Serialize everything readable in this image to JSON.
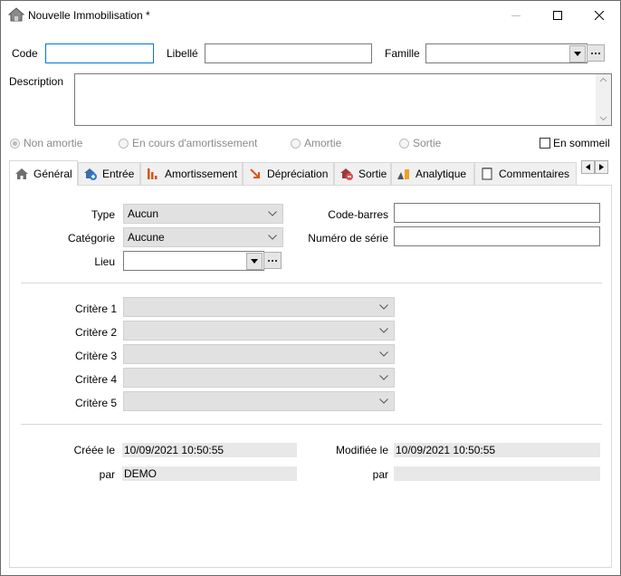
{
  "window": {
    "title": "Nouvelle Immobilisation *"
  },
  "header": {
    "code_label": "Code",
    "code_value": "",
    "libelle_label": "Libellé",
    "libelle_value": "",
    "famille_label": "Famille",
    "famille_value": "",
    "description_label": "Description",
    "description_value": ""
  },
  "status": {
    "options": [
      "Non amortie",
      "En cours d'amortissement",
      "Amortie",
      "Sortie"
    ],
    "selected": "Non amortie",
    "en_sommeil_label": "En sommeil",
    "en_sommeil_checked": false
  },
  "tabs": [
    {
      "label": "Général",
      "icon": "home-icon",
      "active": true
    },
    {
      "label": "Entrée",
      "icon": "add-entry-icon"
    },
    {
      "label": "Amortissement",
      "icon": "bar-chart-icon"
    },
    {
      "label": "Dépréciation",
      "icon": "arrow-down-right-icon"
    },
    {
      "label": "Sortie",
      "icon": "remove-exit-icon"
    },
    {
      "label": "Analytique",
      "icon": "analytics-icon"
    },
    {
      "label": "Commentaires",
      "icon": "notepad-icon"
    }
  ],
  "general": {
    "type_label": "Type",
    "type_value": "Aucun",
    "categorie_label": "Catégorie",
    "categorie_value": "Aucune",
    "lieu_label": "Lieu",
    "lieu_value": "",
    "code_barres_label": "Code-barres",
    "code_barres_value": "",
    "numero_serie_label": "Numéro de série",
    "numero_serie_value": "",
    "criteres": [
      {
        "label": "Critère 1",
        "value": ""
      },
      {
        "label": "Critère 2",
        "value": ""
      },
      {
        "label": "Critère 3",
        "value": ""
      },
      {
        "label": "Critère 4",
        "value": ""
      },
      {
        "label": "Critère 5",
        "value": ""
      }
    ],
    "creee_le_label": "Créée le",
    "creee_le_value": "10/09/2021 10:50:55",
    "creee_par_label": "par",
    "creee_par_value": "DEMO",
    "modifiee_le_label": "Modifiée le",
    "modifiee_le_value": "10/09/2021 10:50:55",
    "modifiee_par_label": "par",
    "modifiee_par_value": ""
  }
}
